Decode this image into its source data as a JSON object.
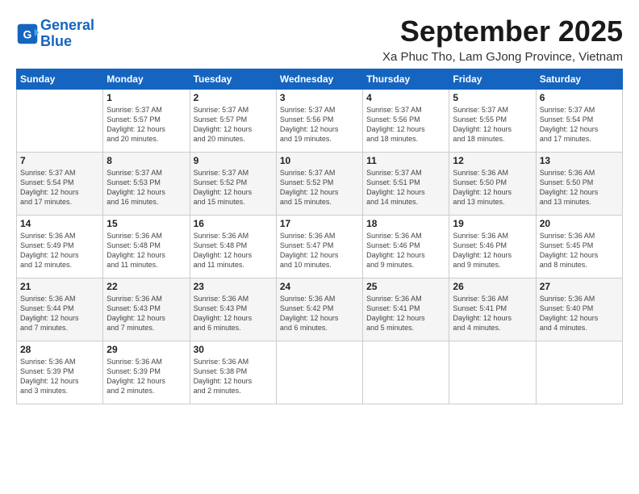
{
  "header": {
    "logo_line1": "General",
    "logo_line2": "Blue",
    "month_title": "September 2025",
    "subtitle": "Xa Phuc Tho, Lam GJong Province, Vietnam"
  },
  "weekdays": [
    "Sunday",
    "Monday",
    "Tuesday",
    "Wednesday",
    "Thursday",
    "Friday",
    "Saturday"
  ],
  "weeks": [
    [
      {
        "day": "",
        "info": ""
      },
      {
        "day": "1",
        "info": "Sunrise: 5:37 AM\nSunset: 5:57 PM\nDaylight: 12 hours\nand 20 minutes."
      },
      {
        "day": "2",
        "info": "Sunrise: 5:37 AM\nSunset: 5:57 PM\nDaylight: 12 hours\nand 20 minutes."
      },
      {
        "day": "3",
        "info": "Sunrise: 5:37 AM\nSunset: 5:56 PM\nDaylight: 12 hours\nand 19 minutes."
      },
      {
        "day": "4",
        "info": "Sunrise: 5:37 AM\nSunset: 5:56 PM\nDaylight: 12 hours\nand 18 minutes."
      },
      {
        "day": "5",
        "info": "Sunrise: 5:37 AM\nSunset: 5:55 PM\nDaylight: 12 hours\nand 18 minutes."
      },
      {
        "day": "6",
        "info": "Sunrise: 5:37 AM\nSunset: 5:54 PM\nDaylight: 12 hours\nand 17 minutes."
      }
    ],
    [
      {
        "day": "7",
        "info": "Sunrise: 5:37 AM\nSunset: 5:54 PM\nDaylight: 12 hours\nand 17 minutes."
      },
      {
        "day": "8",
        "info": "Sunrise: 5:37 AM\nSunset: 5:53 PM\nDaylight: 12 hours\nand 16 minutes."
      },
      {
        "day": "9",
        "info": "Sunrise: 5:37 AM\nSunset: 5:52 PM\nDaylight: 12 hours\nand 15 minutes."
      },
      {
        "day": "10",
        "info": "Sunrise: 5:37 AM\nSunset: 5:52 PM\nDaylight: 12 hours\nand 15 minutes."
      },
      {
        "day": "11",
        "info": "Sunrise: 5:37 AM\nSunset: 5:51 PM\nDaylight: 12 hours\nand 14 minutes."
      },
      {
        "day": "12",
        "info": "Sunrise: 5:36 AM\nSunset: 5:50 PM\nDaylight: 12 hours\nand 13 minutes."
      },
      {
        "day": "13",
        "info": "Sunrise: 5:36 AM\nSunset: 5:50 PM\nDaylight: 12 hours\nand 13 minutes."
      }
    ],
    [
      {
        "day": "14",
        "info": "Sunrise: 5:36 AM\nSunset: 5:49 PM\nDaylight: 12 hours\nand 12 minutes."
      },
      {
        "day": "15",
        "info": "Sunrise: 5:36 AM\nSunset: 5:48 PM\nDaylight: 12 hours\nand 11 minutes."
      },
      {
        "day": "16",
        "info": "Sunrise: 5:36 AM\nSunset: 5:48 PM\nDaylight: 12 hours\nand 11 minutes."
      },
      {
        "day": "17",
        "info": "Sunrise: 5:36 AM\nSunset: 5:47 PM\nDaylight: 12 hours\nand 10 minutes."
      },
      {
        "day": "18",
        "info": "Sunrise: 5:36 AM\nSunset: 5:46 PM\nDaylight: 12 hours\nand 9 minutes."
      },
      {
        "day": "19",
        "info": "Sunrise: 5:36 AM\nSunset: 5:46 PM\nDaylight: 12 hours\nand 9 minutes."
      },
      {
        "day": "20",
        "info": "Sunrise: 5:36 AM\nSunset: 5:45 PM\nDaylight: 12 hours\nand 8 minutes."
      }
    ],
    [
      {
        "day": "21",
        "info": "Sunrise: 5:36 AM\nSunset: 5:44 PM\nDaylight: 12 hours\nand 7 minutes."
      },
      {
        "day": "22",
        "info": "Sunrise: 5:36 AM\nSunset: 5:43 PM\nDaylight: 12 hours\nand 7 minutes."
      },
      {
        "day": "23",
        "info": "Sunrise: 5:36 AM\nSunset: 5:43 PM\nDaylight: 12 hours\nand 6 minutes."
      },
      {
        "day": "24",
        "info": "Sunrise: 5:36 AM\nSunset: 5:42 PM\nDaylight: 12 hours\nand 6 minutes."
      },
      {
        "day": "25",
        "info": "Sunrise: 5:36 AM\nSunset: 5:41 PM\nDaylight: 12 hours\nand 5 minutes."
      },
      {
        "day": "26",
        "info": "Sunrise: 5:36 AM\nSunset: 5:41 PM\nDaylight: 12 hours\nand 4 minutes."
      },
      {
        "day": "27",
        "info": "Sunrise: 5:36 AM\nSunset: 5:40 PM\nDaylight: 12 hours\nand 4 minutes."
      }
    ],
    [
      {
        "day": "28",
        "info": "Sunrise: 5:36 AM\nSunset: 5:39 PM\nDaylight: 12 hours\nand 3 minutes."
      },
      {
        "day": "29",
        "info": "Sunrise: 5:36 AM\nSunset: 5:39 PM\nDaylight: 12 hours\nand 2 minutes."
      },
      {
        "day": "30",
        "info": "Sunrise: 5:36 AM\nSunset: 5:38 PM\nDaylight: 12 hours\nand 2 minutes."
      },
      {
        "day": "",
        "info": ""
      },
      {
        "day": "",
        "info": ""
      },
      {
        "day": "",
        "info": ""
      },
      {
        "day": "",
        "info": ""
      }
    ]
  ]
}
